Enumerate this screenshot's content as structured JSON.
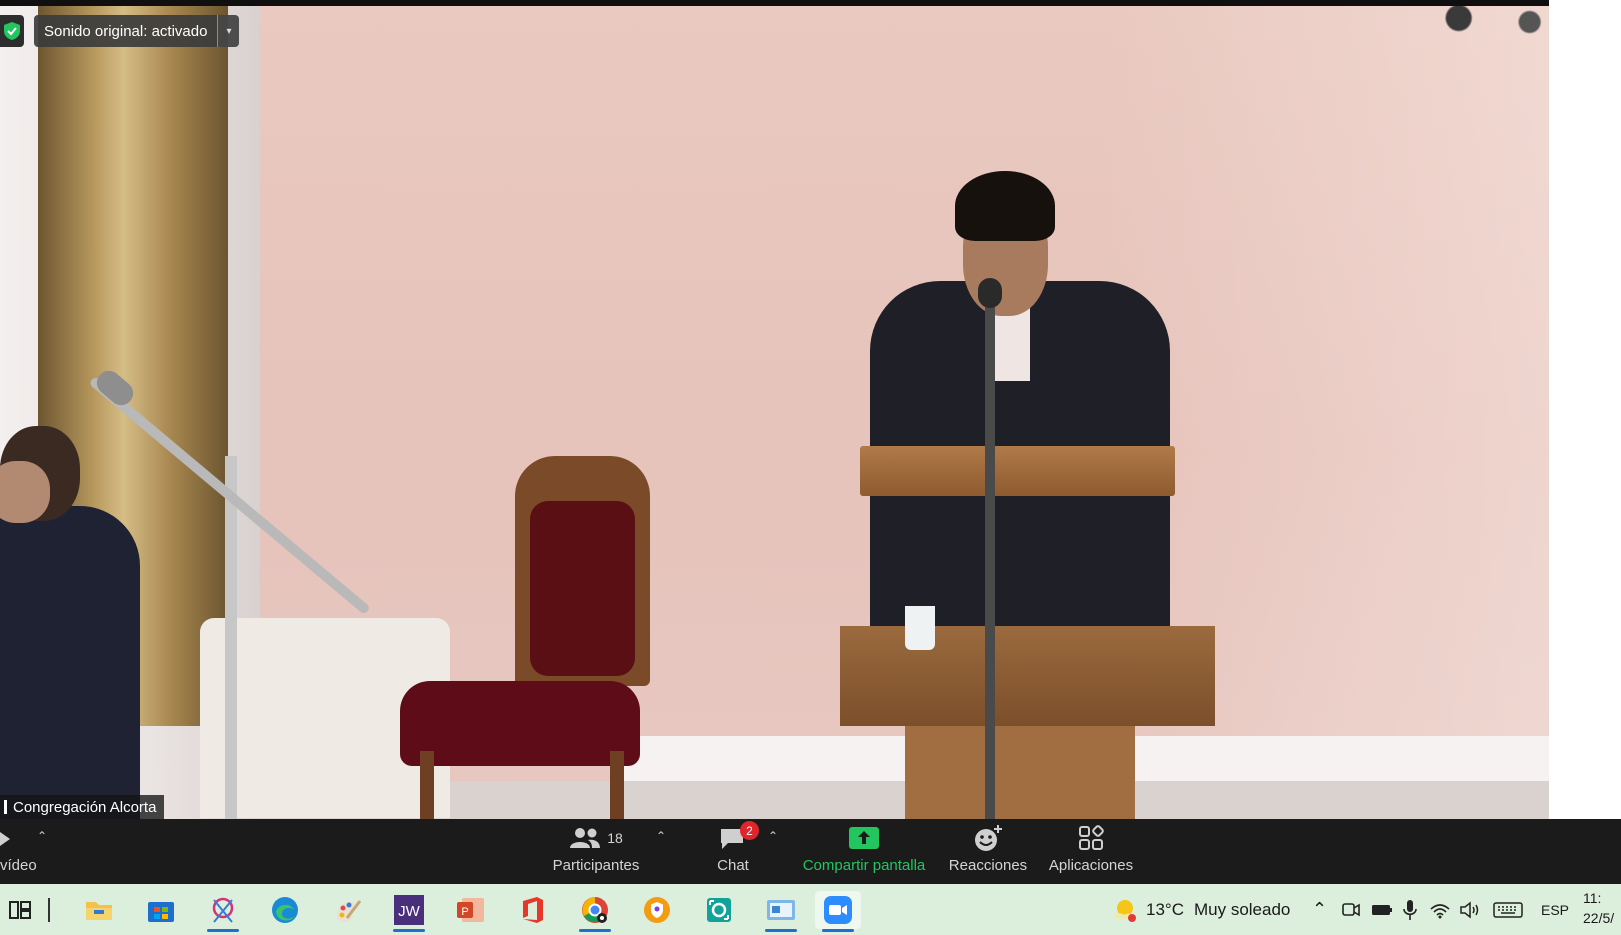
{
  "overlay": {
    "sound_status": "Sonido original: activado",
    "participant_name": "Congregación Alcorta"
  },
  "toolbar": {
    "video_label": "vídeo",
    "participants_label": "Participantes",
    "participants_count": "18",
    "chat_label": "Chat",
    "chat_unread": "2",
    "share_label": "Compartir pantalla",
    "reactions_label": "Reacciones",
    "apps_label": "Aplicaciones"
  },
  "taskbar": {
    "apps": [
      "task-view",
      "file-explorer",
      "microsoft-store",
      "snipping-tool",
      "edge",
      "paint",
      "jw-library",
      "powerpoint",
      "office",
      "chrome",
      "shield-app",
      "screen-capture",
      "control-panel",
      "zoom"
    ],
    "weather_temp": "13°C",
    "weather_text": "Muy soleado",
    "language": "ESP",
    "time": "11:",
    "date": "22/5/"
  },
  "colors": {
    "toolbar_bg": "#1b1b1b",
    "share_green": "#22c55e",
    "badge_red": "#e0242c",
    "taskbar_bg": "#dcefdc"
  }
}
